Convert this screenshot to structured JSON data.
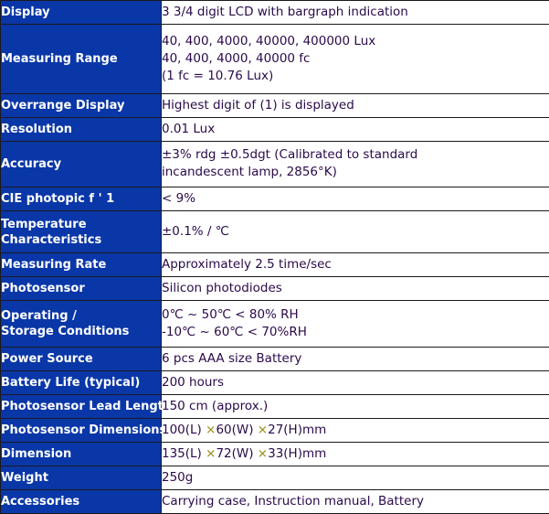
{
  "table": {
    "accent_blue": "#0a37a8",
    "label_text_color": "#ffffff",
    "value_text_color": "#2a0a4a",
    "multiply_sign_color": "#9a8a10",
    "rows": [
      {
        "label": "Display",
        "label_lines": [
          "Display"
        ],
        "value_lines": [
          "3 3/4 digit LCD with bargraph indication"
        ]
      },
      {
        "label": "Measuring Range",
        "label_lines": [
          "Measuring Range"
        ],
        "value_lines": [
          "40, 400, 4000, 40000, 400000 Lux",
          "40, 400, 4000, 40000 fc",
          "(1 fc = 10.76 Lux)"
        ]
      },
      {
        "label": "Overrange Display",
        "label_lines": [
          "Overrange Display"
        ],
        "value_lines": [
          "Highest digit of (1) is displayed"
        ]
      },
      {
        "label": "Resolution",
        "label_lines": [
          "Resolution"
        ],
        "value_lines": [
          "0.01 Lux"
        ]
      },
      {
        "label": "Accuracy",
        "label_lines": [
          "Accuracy"
        ],
        "value_lines": [
          "±3% rdg ±0.5dgt (Calibrated to standard",
          "incandescent lamp, 2856°K)"
        ]
      },
      {
        "label": "CIE photopic f ' 1",
        "label_lines": [
          "CIE photopic f ' 1"
        ],
        "value_lines": [
          "< 9%"
        ]
      },
      {
        "label": "Temperature Characteristics",
        "label_lines": [
          "Temperature",
          "Characteristics"
        ],
        "value_lines": [
          "±0.1% / ℃"
        ]
      },
      {
        "label": "Measuring Rate",
        "label_lines": [
          "Measuring Rate"
        ],
        "value_lines": [
          "Approximately 2.5 time/sec"
        ]
      },
      {
        "label": "Photosensor",
        "label_lines": [
          "Photosensor"
        ],
        "value_lines": [
          "Silicon photodiodes"
        ]
      },
      {
        "label": "Operating / Storage Conditions",
        "label_lines": [
          "Operating /",
          "Storage Conditions"
        ],
        "value_lines": [
          "0℃ ~ 50℃ < 80% RH",
          "-10℃ ~ 60℃ < 70%RH"
        ]
      },
      {
        "label": "Power Source",
        "label_lines": [
          "Power Source"
        ],
        "value_lines": [
          "6 pcs AAA size Battery"
        ]
      },
      {
        "label": "Battery Life (typical)",
        "label_lines": [
          "Battery Life (typical)"
        ],
        "value_lines": [
          "200 hours"
        ]
      },
      {
        "label": "Photosensor Lead Length",
        "label_lines": [
          "Photosensor Lead Length"
        ],
        "value_lines": [
          "150 cm (approx.)"
        ]
      },
      {
        "label": "Photosensor Dimensions",
        "label_lines": [
          "Photosensor Dimensions"
        ],
        "value_html": "100(L) <span class=\"mult\">×</span>60(W) <span class=\"mult\">×</span>27(H)mm",
        "value_lines": [
          "100(L) ×60(W) ×27(H)mm"
        ]
      },
      {
        "label": "Dimension",
        "label_lines": [
          "Dimension"
        ],
        "value_html": "135(L) <span class=\"mult\">×</span>72(W) <span class=\"mult\">×</span>33(H)mm",
        "value_lines": [
          "135(L) ×72(W) ×33(H)mm"
        ]
      },
      {
        "label": "Weight",
        "label_lines": [
          "Weight"
        ],
        "value_lines": [
          "250g"
        ]
      },
      {
        "label": "Accessories",
        "label_lines": [
          "Accessories"
        ],
        "value_lines": [
          "Carrying case, Instruction manual, Battery"
        ]
      }
    ]
  }
}
